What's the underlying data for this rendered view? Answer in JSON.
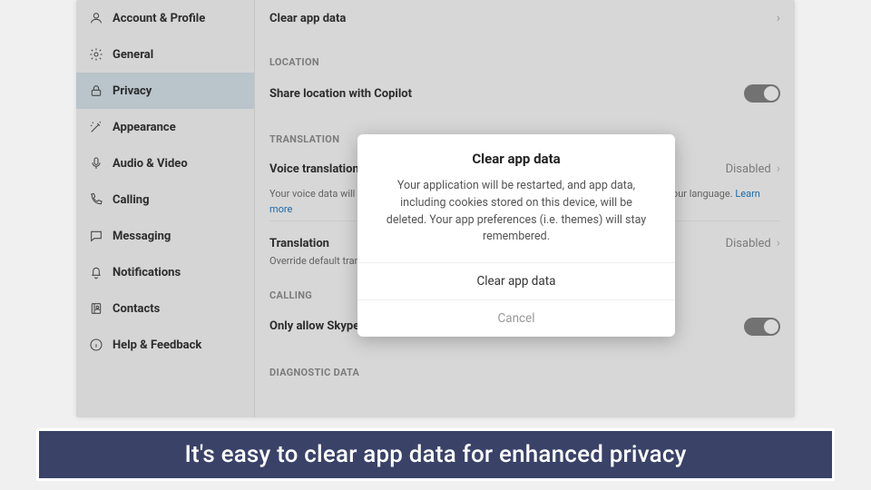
{
  "sidebar": {
    "items": [
      {
        "label": "Account & Profile",
        "icon": "person"
      },
      {
        "label": "General",
        "icon": "gear"
      },
      {
        "label": "Privacy",
        "icon": "lock",
        "active": true
      },
      {
        "label": "Appearance",
        "icon": "wand"
      },
      {
        "label": "Audio & Video",
        "icon": "mic"
      },
      {
        "label": "Calling",
        "icon": "phone"
      },
      {
        "label": "Messaging",
        "icon": "chat"
      },
      {
        "label": "Notifications",
        "icon": "bell"
      },
      {
        "label": "Contacts",
        "icon": "book"
      },
      {
        "label": "Help & Feedback",
        "icon": "info"
      }
    ]
  },
  "content": {
    "clear_row": "Clear app data",
    "location_section": "LOCATION",
    "share_location": "Share location with Copilot",
    "translation_section": "TRANSLATION",
    "voice_row": "Voice translation",
    "voice_hint_prefix": "Your voice data will help improve audio and translation products for everyone who speaks your language. ",
    "voice_hint_link": "Learn more",
    "trans_row": "Translation",
    "trans_hint": "Override default translation settings",
    "disabled_tag": "Disabled",
    "calling_section": "CALLING",
    "calling_row": "Only allow Skype calls from contacts to ring on this device",
    "diag_section": "DIAGNOSTIC DATA"
  },
  "modal": {
    "title": "Clear app data",
    "body": "Your application will be restarted, and app data, including cookies stored on this device, will be deleted. Your app preferences (i.e. themes) will stay remembered.",
    "confirm": "Clear app data",
    "cancel": "Cancel"
  },
  "caption": "It's easy to clear app data for enhanced privacy"
}
